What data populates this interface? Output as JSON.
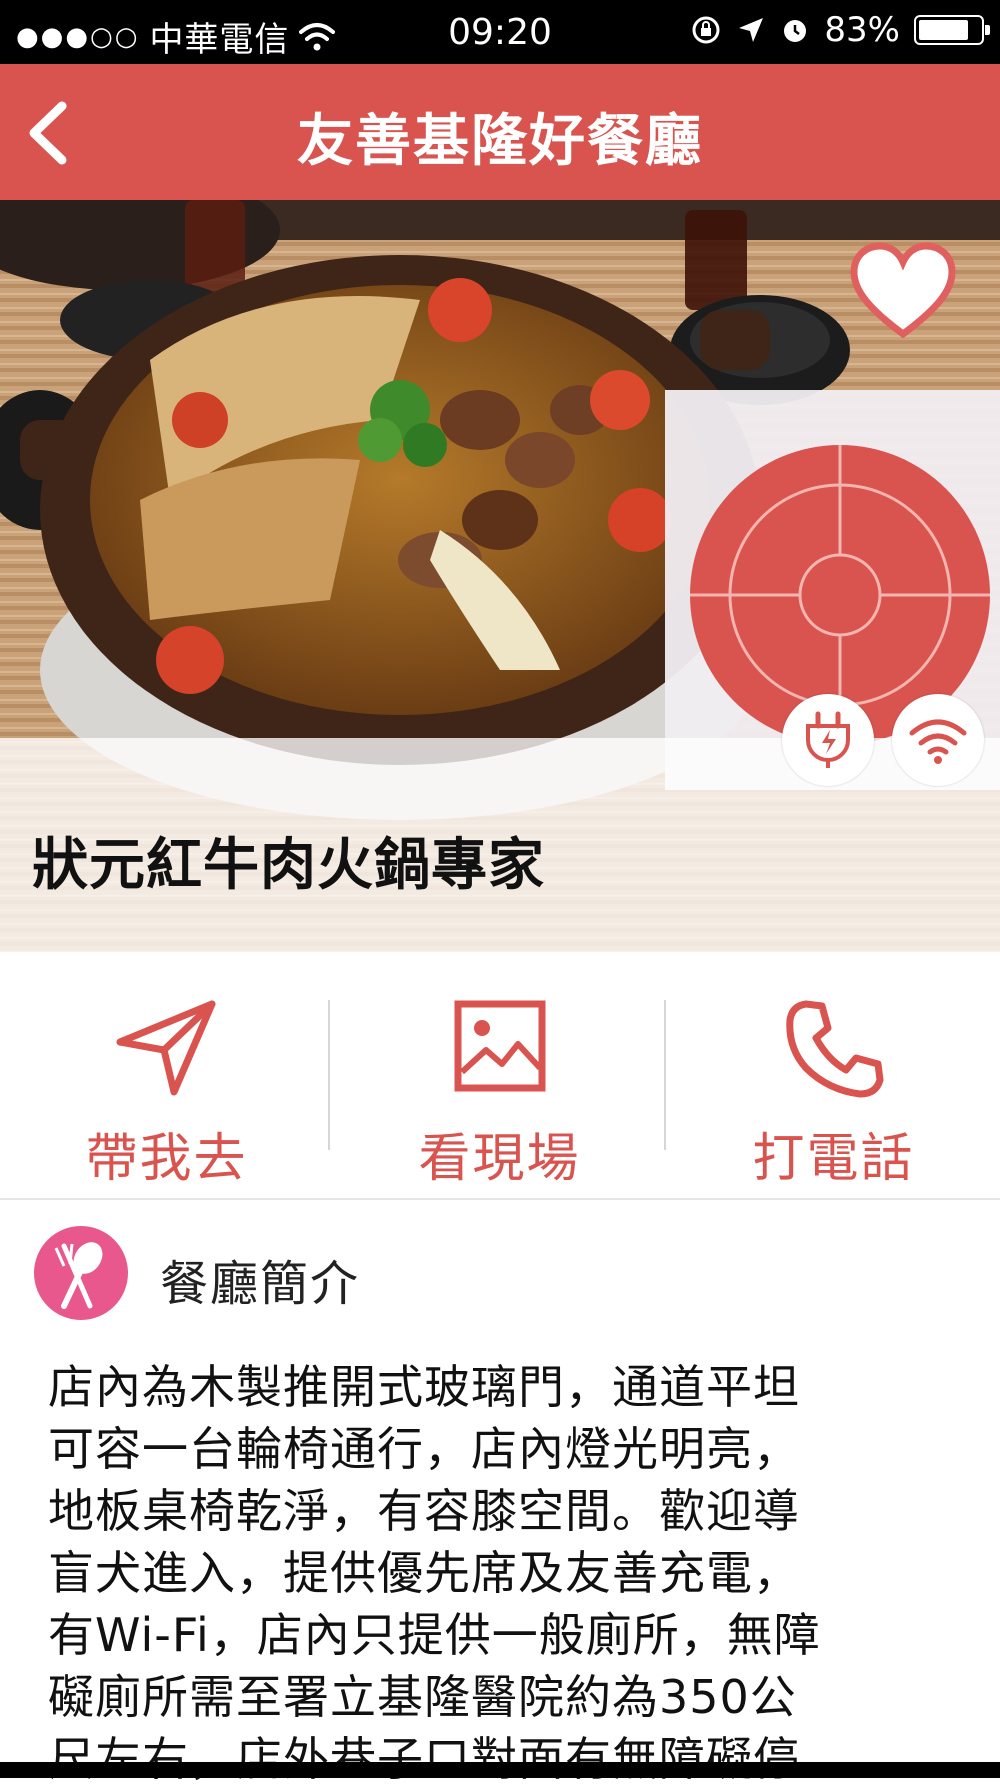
{
  "status_bar": {
    "signal": "●●●○○",
    "carrier": "中華電信",
    "time": "09:20",
    "battery": "83%",
    "battery_level": 0.83
  },
  "nav": {
    "title": "友善基隆好餐廳",
    "back_icon": "chevron-left-icon"
  },
  "restaurant": {
    "name": "狀元紅牛肉火鍋專家",
    "favorite_icon": "heart-icon",
    "amenities": [
      "power-plug-icon",
      "wifi-icon"
    ]
  },
  "actions": [
    {
      "label": "帶我去",
      "icon": "navigate-arrow-icon"
    },
    {
      "label": "看現場",
      "icon": "image-icon"
    },
    {
      "label": "打電話",
      "icon": "phone-icon"
    }
  ],
  "section": {
    "title": "餐廳簡介",
    "icon": "fork-spoon-icon"
  },
  "description_lines": [
    "店內為木製推開式玻璃門，通道平坦",
    "可容一台輪椅通行，店內燈光明亮，",
    "地板桌椅乾淨，有容膝空間。歡迎導",
    "盲犬進入，提供優先席及友善充電，",
    "有Wi-Fi，店內只提供一般廁所，無障",
    "礙廁所需至署立基隆醫院約為350公",
    "尺左右，店外巷子口對面有無障礙停"
  ],
  "colors": {
    "accent": "#d9534f",
    "section_icon": "#e8588d"
  }
}
